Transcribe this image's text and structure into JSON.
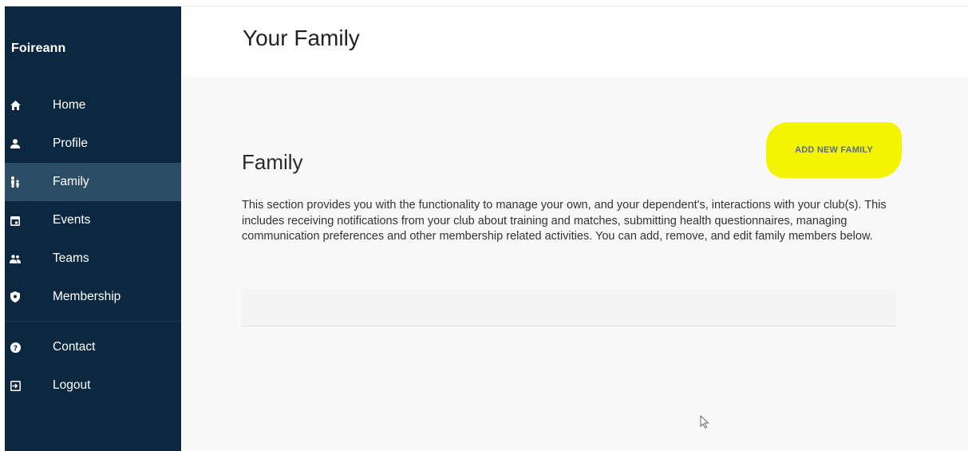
{
  "app": {
    "brand": "Foireann"
  },
  "sidebar": {
    "items": [
      {
        "label": "Home",
        "icon": "home-icon"
      },
      {
        "label": "Profile",
        "icon": "person-icon"
      },
      {
        "label": "Family",
        "icon": "family-icon",
        "active": true
      },
      {
        "label": "Events",
        "icon": "calendar-icon"
      },
      {
        "label": "Teams",
        "icon": "people-icon"
      },
      {
        "label": "Membership",
        "icon": "shield-icon"
      }
    ],
    "secondary": [
      {
        "label": "Contact",
        "icon": "help-icon"
      },
      {
        "label": "Logout",
        "icon": "logout-icon"
      }
    ]
  },
  "page": {
    "title": "Your Family"
  },
  "family": {
    "title": "Family",
    "add_button": "ADD NEW FAMILY",
    "description": "This section provides you with the functionality to manage your own, and your dependent's, interactions with your club(s). This includes receiving notifications from your club about training and matches, submitting health questionnaires, managing communication preferences and other membership related activities. You can add, remove, and edit family members below."
  },
  "colors": {
    "sidebar_bg": "#0c2840",
    "sidebar_active": "#2c4d66",
    "highlight": "#f3f500",
    "button_text": "#5b6a8a"
  }
}
